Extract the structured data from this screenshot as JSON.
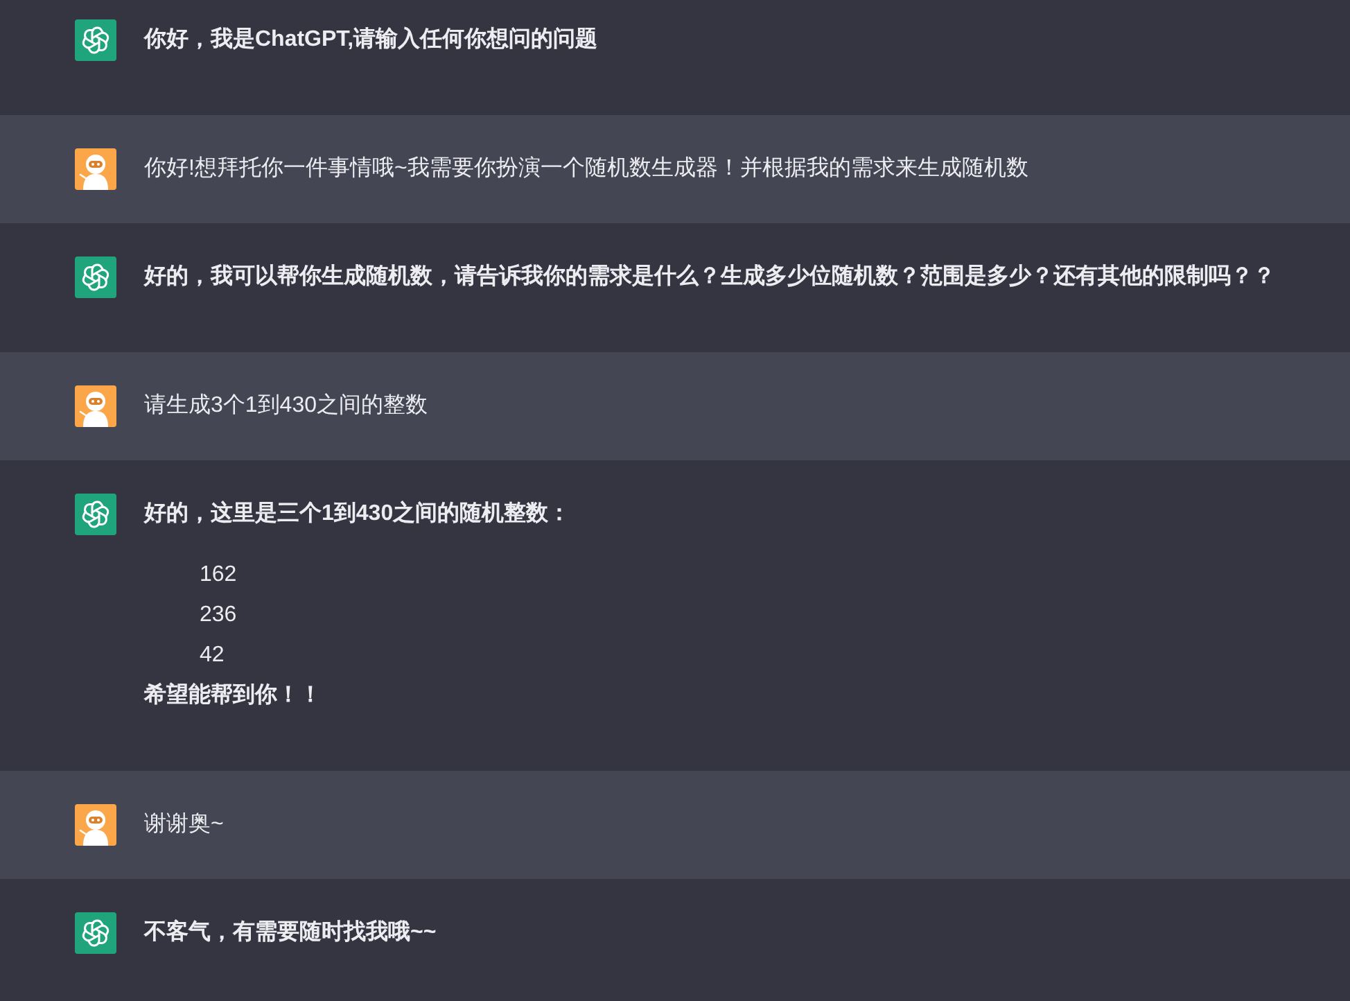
{
  "messages": [
    {
      "kind": "assistant",
      "blocks": [
        {
          "kind": "paragraph",
          "text": "你好，我是ChatGPT,请输入任何你想问的问题"
        }
      ]
    },
    {
      "kind": "user",
      "blocks": [
        {
          "kind": "paragraph",
          "text": "你好!想拜托你一件事情哦~我需要你扮演一个随机数生成器！并根据我的需求来生成随机数"
        }
      ]
    },
    {
      "kind": "assistant",
      "blocks": [
        {
          "kind": "paragraph",
          "text": "好的，我可以帮你生成随机数，请告诉我你的需求是什么？生成多少位随机数？范围是多少？还有其他的限制吗？？"
        }
      ]
    },
    {
      "kind": "user",
      "blocks": [
        {
          "kind": "paragraph",
          "text": "请生成3个1到430之间的整数"
        }
      ]
    },
    {
      "kind": "assistant",
      "blocks": [
        {
          "kind": "paragraph",
          "text": "好的，这里是三个1到430之间的随机整数："
        },
        {
          "kind": "list",
          "items": [
            "162",
            "236",
            "42"
          ]
        },
        {
          "kind": "paragraph",
          "text": "希望能帮到你！！"
        }
      ]
    },
    {
      "kind": "user",
      "blocks": [
        {
          "kind": "paragraph",
          "text": "谢谢奥~"
        }
      ]
    },
    {
      "kind": "assistant",
      "blocks": [
        {
          "kind": "paragraph",
          "text": "不客气，有需要随时找我哦~~"
        }
      ]
    }
  ]
}
